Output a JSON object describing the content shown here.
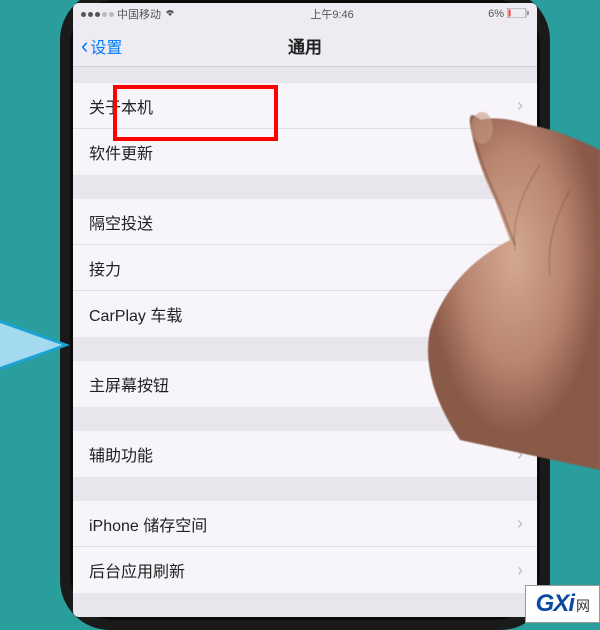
{
  "status": {
    "carrier": "中国移动",
    "time": "上午9:46",
    "battery": "6%"
  },
  "nav": {
    "back": "设置",
    "title": "通用"
  },
  "sections": [
    {
      "items": [
        {
          "label": "关于本机"
        },
        {
          "label": "软件更新"
        }
      ]
    },
    {
      "items": [
        {
          "label": "隔空投送"
        },
        {
          "label": "接力"
        },
        {
          "label": "CarPlay 车载"
        }
      ]
    },
    {
      "items": [
        {
          "label": "主屏幕按钮"
        }
      ]
    },
    {
      "items": [
        {
          "label": "辅助功能"
        }
      ]
    },
    {
      "items": [
        {
          "label": "iPhone 储存空间"
        },
        {
          "label": "后台应用刷新"
        }
      ]
    }
  ],
  "watermark": {
    "brand": "GXi",
    "suffix": "网"
  }
}
